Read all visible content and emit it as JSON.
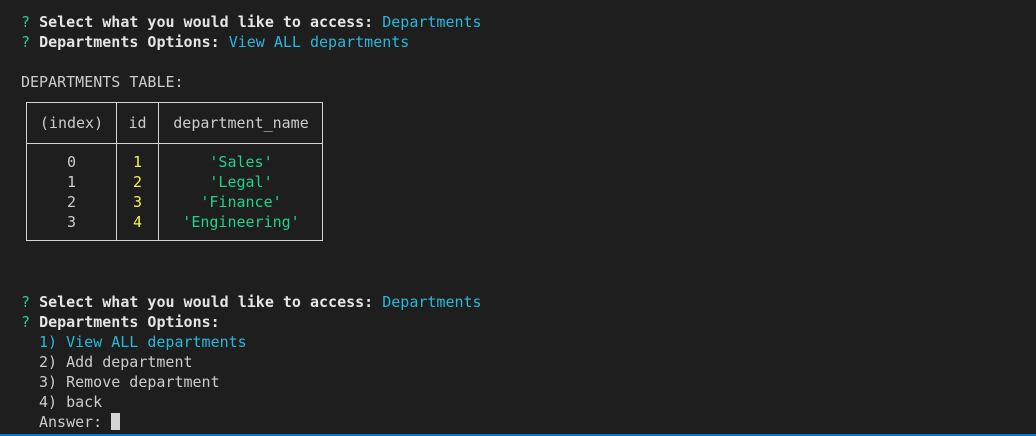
{
  "prompt_symbol": "?",
  "prompt1": {
    "question": "Select what you would like to access:",
    "answer": "Departments"
  },
  "prompt2": {
    "question": "Departments Options:",
    "answer": "View ALL departments"
  },
  "table_title": "DEPARTMENTS TABLE:",
  "table": {
    "columns": [
      "(index)",
      "id",
      "department_name"
    ],
    "rows": [
      {
        "index": "0",
        "id": "1",
        "department_name": "'Sales'"
      },
      {
        "index": "1",
        "id": "2",
        "department_name": "'Legal'"
      },
      {
        "index": "2",
        "id": "3",
        "department_name": "'Finance'"
      },
      {
        "index": "3",
        "id": "4",
        "department_name": "'Engineering'"
      }
    ]
  },
  "prompt3": {
    "question": "Select what you would like to access:",
    "answer": "Departments"
  },
  "prompt4": {
    "question": "Departments Options:"
  },
  "menu": {
    "items": [
      "1) View ALL departments",
      "2) Add department",
      "3) Remove department",
      "4) back"
    ],
    "answer_label": "Answer:",
    "answer_value": ""
  }
}
